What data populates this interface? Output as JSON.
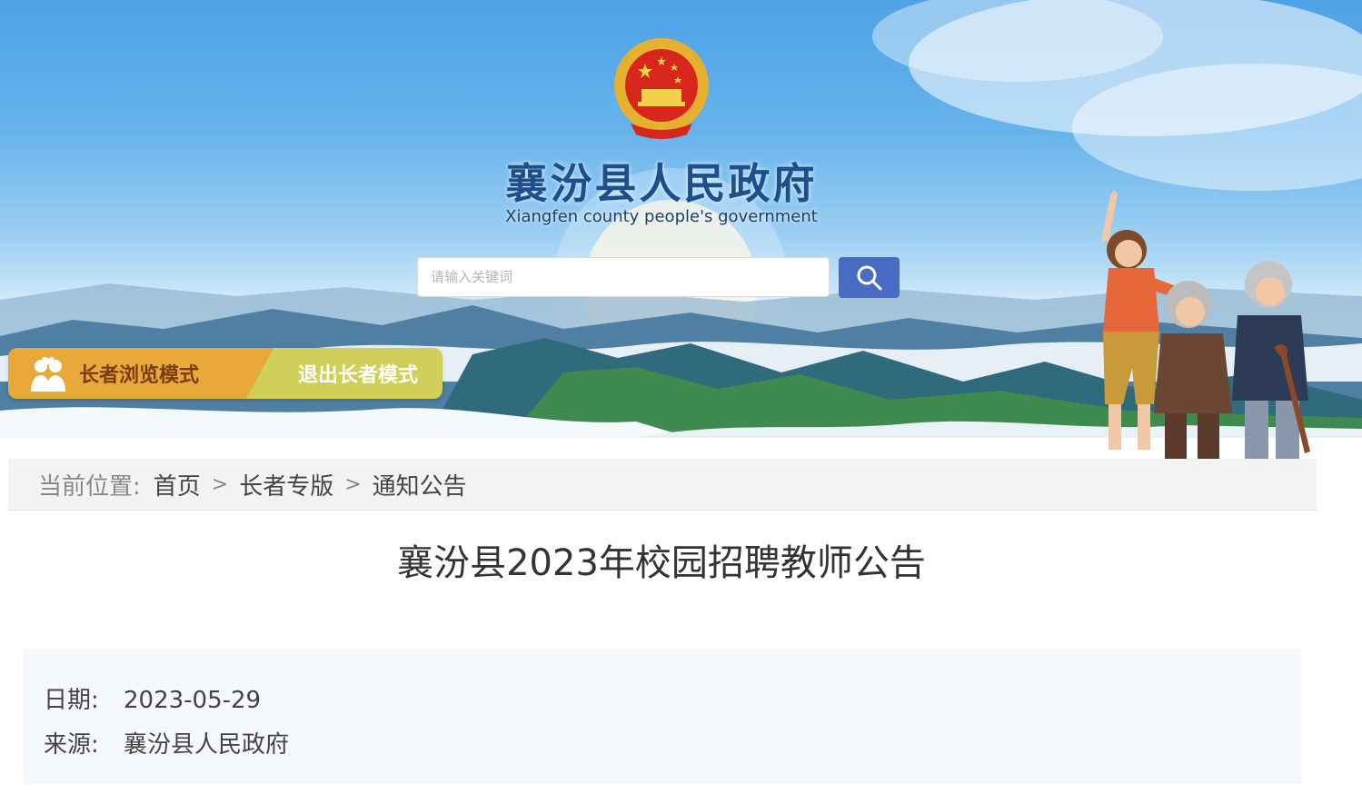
{
  "header": {
    "title": "襄汾县人民政府",
    "subtitle": "Xiangfen county people's government",
    "search": {
      "placeholder": "请输入关键词",
      "value": ""
    },
    "elder_mode_label": "长者浏览模式",
    "exit_elder_label": "退出长者模式",
    "icons": [
      "national-emblem",
      "search-icon",
      "elder-icon"
    ]
  },
  "breadcrumb": {
    "prefix": "当前位置:",
    "items": [
      "首页",
      "长者专版",
      "通知公告"
    ],
    "separator": ">"
  },
  "article": {
    "title": "襄汾县2023年校园招聘教师公告",
    "date_label": "日期:",
    "date": "2023-05-29",
    "source_label": "来源:",
    "source": "襄汾县人民政府"
  },
  "colors": {
    "title": "#1d4f8c",
    "search_button": "#4a6bc4",
    "elder_mode": "#e8a93a",
    "exit_elder": "#cfcf59",
    "breadcrumb_bg": "#f3f3f3",
    "meta_bg": "#f5f8fc"
  }
}
